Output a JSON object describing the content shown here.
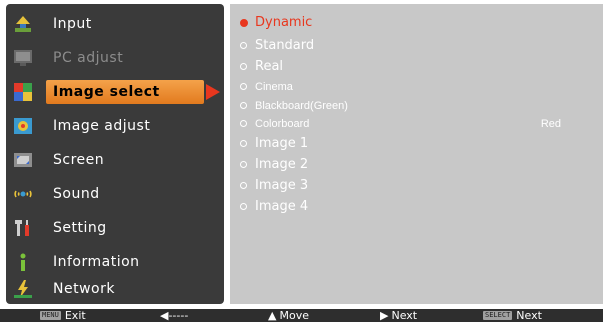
{
  "menu": {
    "items": [
      {
        "label": "Input",
        "icon": "input-icon",
        "state": "normal"
      },
      {
        "label": "PC adjust",
        "icon": "monitor-icon",
        "state": "disabled"
      },
      {
        "label": "Image select",
        "icon": "image-select-icon",
        "state": "selected"
      },
      {
        "label": "Image adjust",
        "icon": "image-adjust-icon",
        "state": "normal"
      },
      {
        "label": "Screen",
        "icon": "screen-icon",
        "state": "normal"
      },
      {
        "label": "Sound",
        "icon": "sound-icon",
        "state": "normal"
      },
      {
        "label": "Setting",
        "icon": "setting-icon",
        "state": "normal"
      },
      {
        "label": "Information",
        "icon": "information-icon",
        "state": "normal"
      },
      {
        "label": "Network",
        "icon": "network-icon",
        "state": "normal"
      }
    ]
  },
  "options": {
    "items": [
      {
        "label": "Dynamic",
        "selected": true
      },
      {
        "label": "Standard",
        "selected": false
      },
      {
        "label": "Real",
        "selected": false
      },
      {
        "label": "Cinema",
        "selected": false
      },
      {
        "label": "Blackboard(Green)",
        "selected": false
      },
      {
        "label": "Colorboard",
        "selected": false,
        "value": "Red"
      },
      {
        "label": "Image 1",
        "selected": false
      },
      {
        "label": "Image 2",
        "selected": false
      },
      {
        "label": "Image 3",
        "selected": false
      },
      {
        "label": "Image 4",
        "selected": false
      }
    ]
  },
  "footer": {
    "exit_key": "MENU",
    "exit_label": "Exit",
    "back_label": "◀-----",
    "move_label": "Move",
    "next_label": "Next",
    "select_key": "SELECT",
    "select_label": "Next"
  },
  "colors": {
    "accent": "#e8371e",
    "selection": "#f0902e",
    "menu_bg": "#3a3a3a",
    "options_bg": "#c8c8c8"
  }
}
